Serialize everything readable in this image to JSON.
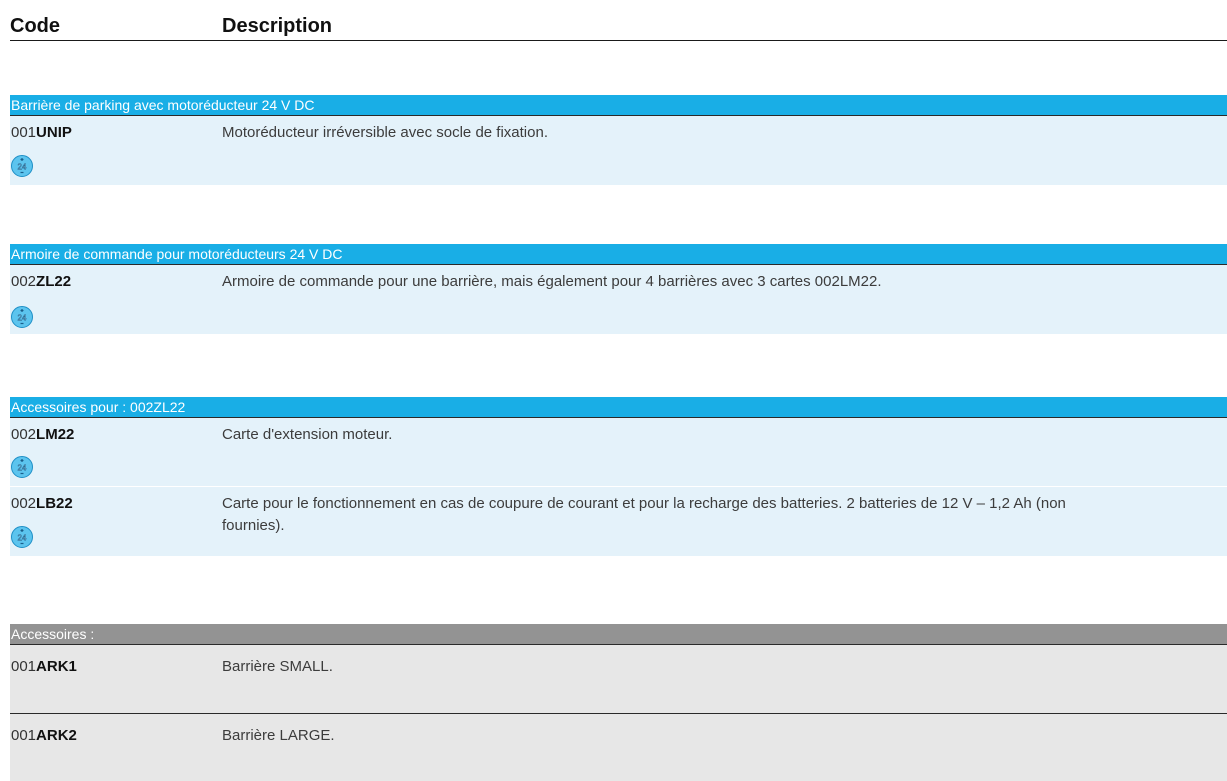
{
  "header": {
    "code": "Code",
    "description": "Description"
  },
  "sections": [
    {
      "title": "Barrière de parking avec motoréducteur 24 V DC",
      "items": [
        {
          "prefix": "001",
          "suffix": "UNIP",
          "description": "Motoréducteur irréversible avec socle de fixation.",
          "badge": "24",
          "badge_icon": "24v-dc-icon"
        }
      ]
    },
    {
      "title": "Armoire de commande pour motoréducteurs 24 V DC",
      "items": [
        {
          "prefix": "002",
          "suffix": "ZL22",
          "description": "Armoire de commande pour une barrière, mais également pour 4 barrières avec 3 cartes 002LM22.",
          "badge": "24",
          "badge_icon": "24v-dc-icon"
        }
      ]
    },
    {
      "title": "Accessoires pour : 002ZL22",
      "items": [
        {
          "prefix": "002",
          "suffix": "LM22",
          "description": "Carte d'extension moteur.",
          "badge": "24",
          "badge_icon": "24v-dc-icon"
        },
        {
          "prefix": "002",
          "suffix": "LB22",
          "description": "Carte pour le fonctionnement en cas de coupure de courant et pour la recharge des batteries. 2 batteries de 12 V – 1,2 Ah (non fournies).",
          "badge": "24",
          "badge_icon": "24v-dc-icon"
        }
      ]
    },
    {
      "title": "Accessoires :",
      "items": [
        {
          "prefix": "001",
          "suffix": "ARK1",
          "description": "Barrière SMALL."
        },
        {
          "prefix": "001",
          "suffix": "ARK2",
          "description": "Barrière LARGE."
        }
      ]
    }
  ],
  "colors": {
    "accent_blue": "#19aee6",
    "row_blue": "#e4f2fa",
    "accent_gray": "#939393",
    "row_gray": "#e7e7e7"
  }
}
